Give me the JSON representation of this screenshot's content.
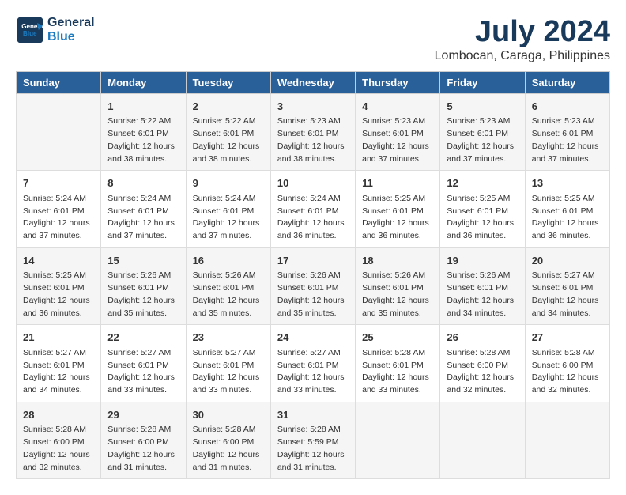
{
  "logo": {
    "line1": "General",
    "line2": "Blue"
  },
  "title": "July 2024",
  "subtitle": "Lombocan, Caraga, Philippines",
  "days": [
    "Sunday",
    "Monday",
    "Tuesday",
    "Wednesday",
    "Thursday",
    "Friday",
    "Saturday"
  ],
  "weeks": [
    [
      {
        "day": "",
        "content": ""
      },
      {
        "day": "1",
        "content": "Sunrise: 5:22 AM\nSunset: 6:01 PM\nDaylight: 12 hours\nand 38 minutes."
      },
      {
        "day": "2",
        "content": "Sunrise: 5:22 AM\nSunset: 6:01 PM\nDaylight: 12 hours\nand 38 minutes."
      },
      {
        "day": "3",
        "content": "Sunrise: 5:23 AM\nSunset: 6:01 PM\nDaylight: 12 hours\nand 38 minutes."
      },
      {
        "day": "4",
        "content": "Sunrise: 5:23 AM\nSunset: 6:01 PM\nDaylight: 12 hours\nand 37 minutes."
      },
      {
        "day": "5",
        "content": "Sunrise: 5:23 AM\nSunset: 6:01 PM\nDaylight: 12 hours\nand 37 minutes."
      },
      {
        "day": "6",
        "content": "Sunrise: 5:23 AM\nSunset: 6:01 PM\nDaylight: 12 hours\nand 37 minutes."
      }
    ],
    [
      {
        "day": "7",
        "content": "Sunrise: 5:24 AM\nSunset: 6:01 PM\nDaylight: 12 hours\nand 37 minutes."
      },
      {
        "day": "8",
        "content": "Sunrise: 5:24 AM\nSunset: 6:01 PM\nDaylight: 12 hours\nand 37 minutes."
      },
      {
        "day": "9",
        "content": "Sunrise: 5:24 AM\nSunset: 6:01 PM\nDaylight: 12 hours\nand 37 minutes."
      },
      {
        "day": "10",
        "content": "Sunrise: 5:24 AM\nSunset: 6:01 PM\nDaylight: 12 hours\nand 36 minutes."
      },
      {
        "day": "11",
        "content": "Sunrise: 5:25 AM\nSunset: 6:01 PM\nDaylight: 12 hours\nand 36 minutes."
      },
      {
        "day": "12",
        "content": "Sunrise: 5:25 AM\nSunset: 6:01 PM\nDaylight: 12 hours\nand 36 minutes."
      },
      {
        "day": "13",
        "content": "Sunrise: 5:25 AM\nSunset: 6:01 PM\nDaylight: 12 hours\nand 36 minutes."
      }
    ],
    [
      {
        "day": "14",
        "content": "Sunrise: 5:25 AM\nSunset: 6:01 PM\nDaylight: 12 hours\nand 36 minutes."
      },
      {
        "day": "15",
        "content": "Sunrise: 5:26 AM\nSunset: 6:01 PM\nDaylight: 12 hours\nand 35 minutes."
      },
      {
        "day": "16",
        "content": "Sunrise: 5:26 AM\nSunset: 6:01 PM\nDaylight: 12 hours\nand 35 minutes."
      },
      {
        "day": "17",
        "content": "Sunrise: 5:26 AM\nSunset: 6:01 PM\nDaylight: 12 hours\nand 35 minutes."
      },
      {
        "day": "18",
        "content": "Sunrise: 5:26 AM\nSunset: 6:01 PM\nDaylight: 12 hours\nand 35 minutes."
      },
      {
        "day": "19",
        "content": "Sunrise: 5:26 AM\nSunset: 6:01 PM\nDaylight: 12 hours\nand 34 minutes."
      },
      {
        "day": "20",
        "content": "Sunrise: 5:27 AM\nSunset: 6:01 PM\nDaylight: 12 hours\nand 34 minutes."
      }
    ],
    [
      {
        "day": "21",
        "content": "Sunrise: 5:27 AM\nSunset: 6:01 PM\nDaylight: 12 hours\nand 34 minutes."
      },
      {
        "day": "22",
        "content": "Sunrise: 5:27 AM\nSunset: 6:01 PM\nDaylight: 12 hours\nand 33 minutes."
      },
      {
        "day": "23",
        "content": "Sunrise: 5:27 AM\nSunset: 6:01 PM\nDaylight: 12 hours\nand 33 minutes."
      },
      {
        "day": "24",
        "content": "Sunrise: 5:27 AM\nSunset: 6:01 PM\nDaylight: 12 hours\nand 33 minutes."
      },
      {
        "day": "25",
        "content": "Sunrise: 5:28 AM\nSunset: 6:01 PM\nDaylight: 12 hours\nand 33 minutes."
      },
      {
        "day": "26",
        "content": "Sunrise: 5:28 AM\nSunset: 6:00 PM\nDaylight: 12 hours\nand 32 minutes."
      },
      {
        "day": "27",
        "content": "Sunrise: 5:28 AM\nSunset: 6:00 PM\nDaylight: 12 hours\nand 32 minutes."
      }
    ],
    [
      {
        "day": "28",
        "content": "Sunrise: 5:28 AM\nSunset: 6:00 PM\nDaylight: 12 hours\nand 32 minutes."
      },
      {
        "day": "29",
        "content": "Sunrise: 5:28 AM\nSunset: 6:00 PM\nDaylight: 12 hours\nand 31 minutes."
      },
      {
        "day": "30",
        "content": "Sunrise: 5:28 AM\nSunset: 6:00 PM\nDaylight: 12 hours\nand 31 minutes."
      },
      {
        "day": "31",
        "content": "Sunrise: 5:28 AM\nSunset: 5:59 PM\nDaylight: 12 hours\nand 31 minutes."
      },
      {
        "day": "",
        "content": ""
      },
      {
        "day": "",
        "content": ""
      },
      {
        "day": "",
        "content": ""
      }
    ]
  ]
}
